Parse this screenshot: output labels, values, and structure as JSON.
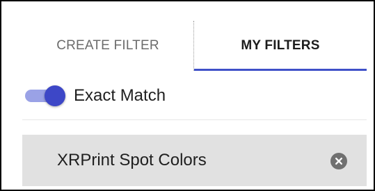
{
  "tabs": {
    "create_filter": "CREATE FILTER",
    "my_filters": "MY FILTERS",
    "active": "my_filters"
  },
  "exact_match": {
    "label": "Exact Match",
    "enabled": true
  },
  "filters": [
    {
      "name": "XRPrint Spot Colors",
      "remove_icon": "close-circle-icon"
    }
  ],
  "colors": {
    "accent": "#3f51c8",
    "toggle_track": "#9aa2e6",
    "toggle_thumb": "#3d47c7",
    "filter_item_bg": "#e1e1e1"
  }
}
